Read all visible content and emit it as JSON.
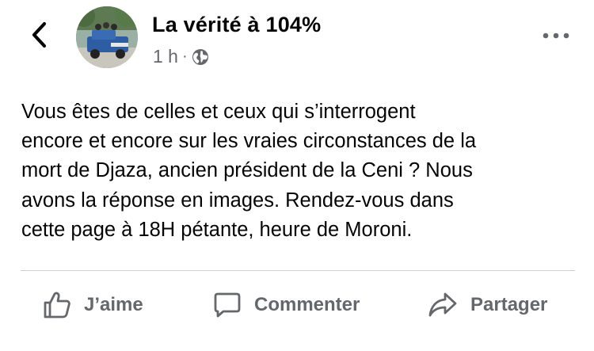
{
  "header": {
    "back_icon": "chevron-left-icon",
    "page_name": "La vérité à 104%",
    "time": "1 h",
    "separator": "·",
    "audience_icon": "globe-icon",
    "more_icon": "more-horizontal-icon"
  },
  "post": {
    "text": "Vous êtes de celles et ceux qui s’interrogent\nencore et encore sur les vraies circonstances de la\nmort de Djaza, ancien président de la Ceni ? Nous\navons la réponse en images. Rendez-vous dans\ncette page à 18H pétante, heure de Moroni."
  },
  "actions": {
    "like_label": "J’aime",
    "comment_label": "Commenter",
    "share_label": "Partager"
  },
  "colors": {
    "text": "#050505",
    "secondary": "#65676b",
    "divider": "#ced0d4",
    "background": "#ffffff"
  }
}
